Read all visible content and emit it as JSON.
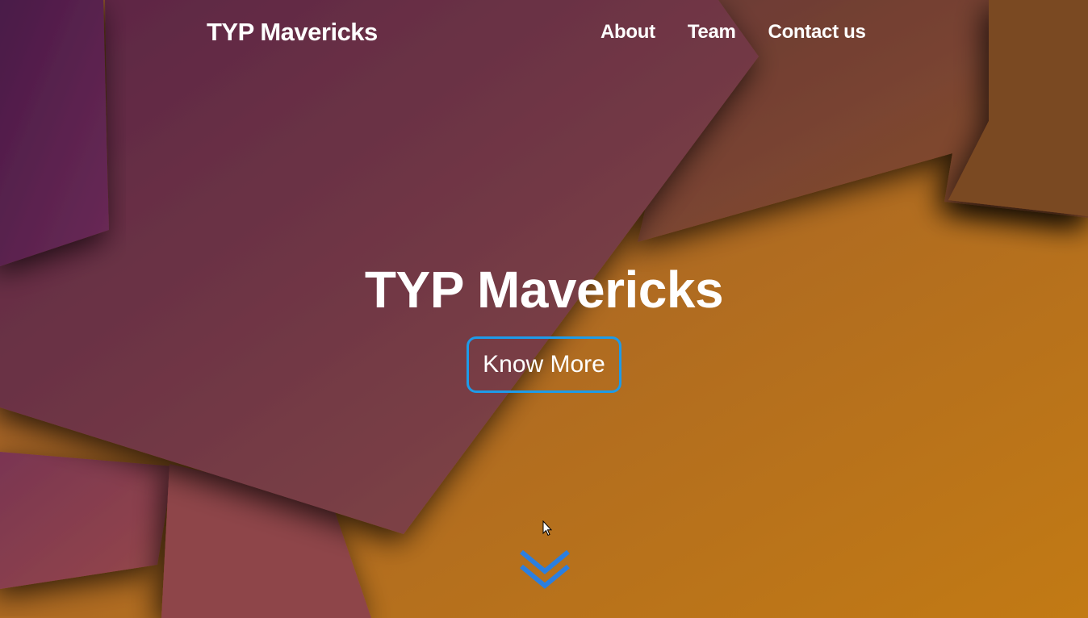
{
  "navbar": {
    "brand": "TYP Mavericks",
    "links": [
      {
        "label": "About"
      },
      {
        "label": "Team"
      },
      {
        "label": "Contact us"
      }
    ]
  },
  "hero": {
    "title": "TYP Mavericks",
    "cta_label": "Know More"
  },
  "icons": {
    "scroll_down": "double-chevron-down-icon",
    "cursor": "mouse-pointer-icon"
  },
  "colors": {
    "accent": "#1e9be8",
    "chevron": "#2b7fe0",
    "text": "#ffffff"
  }
}
